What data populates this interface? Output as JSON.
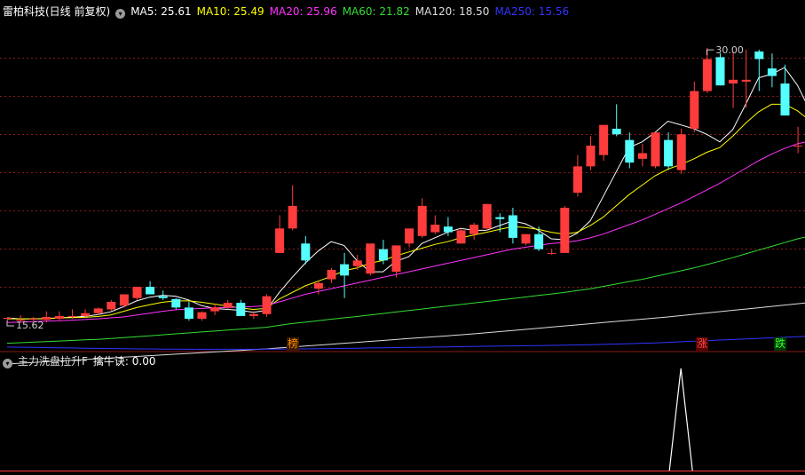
{
  "header": {
    "stock_title": "雷柏科技(日线 前复权)",
    "ma_labels": [
      {
        "text": "MA5: 25.61",
        "color": "#ffffff"
      },
      {
        "text": "MA10: 25.49",
        "color": "#ffff00"
      },
      {
        "text": "MA20: 25.96",
        "color": "#ff33ff"
      },
      {
        "text": "MA60: 21.82",
        "color": "#33dd33"
      },
      {
        "text": "MA120: 18.50",
        "color": "#dddddd"
      },
      {
        "text": "MA250: 15.56",
        "color": "#3333ff"
      }
    ]
  },
  "indicator": {
    "name": "主力洗盘拉升F",
    "value_label": "擒牛诀: 0.00"
  },
  "markers": {
    "high_label": "30.00",
    "low_label": "15.62",
    "tag_bang": "榜",
    "tag_zhang": "涨",
    "tag_die": "跌"
  },
  "colors": {
    "up": "#ff3c3c",
    "down": "#54ffff",
    "background": "#000000",
    "grid": "#8b1a1a",
    "ma5": "#ffffff",
    "ma10": "#ffff00",
    "ma20": "#ff33ff",
    "ma60": "#33dd33",
    "ma120": "#dddddd",
    "ma250": "#3333ff"
  },
  "chart_data": [
    {
      "type": "candlestick",
      "title": "雷柏科技(日线 前复权)",
      "ylim": [
        14.3,
        31.8
      ],
      "high_marker": 30.0,
      "low_marker": 15.62,
      "ohlc": [
        [
          15.9,
          16.0,
          15.8,
          15.95
        ],
        [
          15.8,
          16.1,
          15.7,
          15.85
        ],
        [
          15.9,
          16.0,
          15.8,
          15.9
        ],
        [
          15.85,
          16.3,
          15.7,
          16.0
        ],
        [
          15.9,
          16.3,
          15.8,
          16.05
        ],
        [
          16.0,
          16.4,
          15.9,
          16.05
        ],
        [
          16.05,
          16.4,
          16.0,
          16.2
        ],
        [
          16.2,
          16.5,
          16.1,
          16.45
        ],
        [
          16.4,
          16.9,
          16.3,
          16.8
        ],
        [
          16.6,
          17.1,
          16.5,
          17.2
        ],
        [
          17.0,
          17.6,
          16.9,
          17.6
        ],
        [
          17.6,
          17.9,
          17.4,
          17.2
        ],
        [
          17.1,
          17.4,
          16.9,
          17.0
        ],
        [
          16.95,
          17.0,
          16.4,
          16.5
        ],
        [
          16.5,
          16.8,
          15.8,
          15.9
        ],
        [
          15.9,
          16.3,
          15.8,
          16.25
        ],
        [
          16.3,
          16.7,
          16.1,
          16.5
        ],
        [
          16.5,
          16.9,
          16.4,
          16.75
        ],
        [
          16.75,
          16.9,
          16.1,
          16.05
        ],
        [
          16.05,
          16.3,
          15.9,
          16.15
        ],
        [
          16.15,
          17.2,
          16.0,
          17.1
        ],
        [
          19.4,
          21.4,
          19.4,
          20.7
        ],
        [
          20.7,
          23.0,
          20.6,
          21.9
        ],
        [
          19.9,
          20.3,
          18.8,
          19.0
        ],
        [
          17.5,
          17.9,
          17.2,
          17.8
        ],
        [
          18.0,
          18.6,
          17.8,
          18.5
        ],
        [
          18.8,
          19.4,
          17.0,
          18.2
        ],
        [
          18.7,
          19.3,
          18.5,
          19.0
        ],
        [
          18.3,
          19.8,
          18.2,
          19.9
        ],
        [
          19.6,
          20.1,
          18.8,
          19.0
        ],
        [
          18.4,
          19.8,
          18.1,
          19.8
        ],
        [
          19.9,
          20.5,
          19.7,
          20.7
        ],
        [
          20.3,
          22.3,
          20.2,
          21.9
        ],
        [
          20.5,
          21.4,
          20.4,
          20.9
        ],
        [
          20.8,
          21.3,
          20.3,
          20.5
        ],
        [
          19.9,
          20.7,
          19.9,
          20.6
        ],
        [
          20.4,
          21.0,
          20.1,
          20.9
        ],
        [
          20.7,
          22.0,
          20.6,
          22.0
        ],
        [
          21.3,
          21.5,
          20.5,
          21.2
        ],
        [
          21.4,
          21.8,
          19.9,
          20.2
        ],
        [
          19.9,
          20.4,
          19.8,
          20.4
        ],
        [
          20.4,
          20.8,
          19.5,
          19.6
        ],
        [
          19.4,
          19.6,
          19.3,
          19.4
        ],
        [
          19.4,
          21.9,
          19.4,
          21.8
        ],
        [
          22.6,
          24.6,
          22.4,
          24.0
        ],
        [
          24.0,
          25.6,
          23.8,
          25.1
        ],
        [
          24.6,
          26.2,
          24.3,
          26.2
        ],
        [
          26.0,
          27.3,
          25.6,
          25.7
        ],
        [
          25.4,
          25.8,
          23.9,
          24.2
        ],
        [
          24.4,
          25.2,
          24.0,
          24.7
        ],
        [
          24.0,
          25.8,
          23.9,
          25.8
        ],
        [
          25.4,
          25.8,
          23.8,
          24.0
        ],
        [
          23.8,
          26.0,
          23.6,
          25.7
        ],
        [
          26.0,
          28.5,
          25.8,
          28.0
        ],
        [
          28.0,
          30.3,
          27.9,
          29.7
        ],
        [
          29.8,
          30.0,
          28.3,
          28.3
        ],
        [
          28.4,
          30.1,
          27.1,
          28.6
        ],
        [
          28.5,
          30.2,
          27.1,
          28.6
        ],
        [
          30.1,
          30.2,
          28.0,
          29.7
        ],
        [
          29.2,
          30.0,
          28.2,
          28.8
        ],
        [
          28.4,
          29.4,
          26.9,
          26.7
        ],
        [
          25.1,
          26.1,
          24.7,
          25.1
        ],
        [
          24.8,
          26.6,
          23.6,
          24.3
        ]
      ],
      "ma_series": {
        "MA5": [
          15.95,
          15.9,
          15.9,
          15.92,
          15.95,
          15.98,
          16.03,
          16.12,
          16.27,
          16.55,
          16.85,
          17.05,
          17.15,
          17.1,
          16.9,
          16.6,
          16.45,
          16.4,
          16.35,
          16.25,
          16.35,
          17.3,
          18.1,
          18.85,
          19.5,
          20.0,
          19.8,
          19.0,
          18.4,
          18.4,
          18.95,
          19.2,
          19.9,
          20.2,
          20.5,
          20.7,
          20.6,
          20.6,
          20.85,
          21.1,
          20.95,
          20.6,
          20.15,
          20.1,
          20.45,
          21.1,
          22.4,
          23.7,
          25.0,
          25.3,
          25.8,
          26.4,
          26.2,
          26.0,
          25.7,
          25.3,
          25.95,
          27.3,
          28.7,
          28.9,
          29.25,
          28.3,
          26.9
        ],
        "MA10": [
          15.9,
          15.9,
          15.9,
          15.9,
          15.95,
          15.96,
          15.98,
          16.02,
          16.1,
          16.3,
          16.5,
          16.65,
          16.78,
          16.85,
          16.85,
          16.78,
          16.68,
          16.58,
          16.48,
          16.4,
          16.45,
          16.95,
          17.3,
          17.65,
          17.9,
          18.15,
          18.45,
          18.6,
          18.85,
          19.0,
          19.25,
          19.45,
          19.65,
          19.85,
          20.0,
          20.2,
          20.35,
          20.5,
          20.65,
          20.8,
          20.75,
          20.65,
          20.5,
          20.4,
          20.5,
          20.85,
          21.3,
          21.9,
          22.5,
          23.0,
          23.5,
          23.85,
          24.1,
          24.4,
          24.75,
          25.0,
          25.6,
          26.3,
          26.9,
          27.3,
          27.3,
          26.95,
          26.4
        ],
        "MA20": [
          15.7,
          15.72,
          15.75,
          15.78,
          15.8,
          15.83,
          15.86,
          15.9,
          15.95,
          16.0,
          16.1,
          16.2,
          16.3,
          16.38,
          16.42,
          16.45,
          16.48,
          16.5,
          16.52,
          16.55,
          16.6,
          16.8,
          17.0,
          17.2,
          17.35,
          17.5,
          17.65,
          17.8,
          17.95,
          18.1,
          18.25,
          18.4,
          18.55,
          18.7,
          18.85,
          19.0,
          19.15,
          19.3,
          19.45,
          19.6,
          19.7,
          19.8,
          19.9,
          19.95,
          20.05,
          20.2,
          20.4,
          20.65,
          20.9,
          21.15,
          21.45,
          21.75,
          22.05,
          22.4,
          22.75,
          23.1,
          23.5,
          23.9,
          24.3,
          24.65,
          24.95,
          25.2,
          25.35
        ],
        "MA60": [
          14.6,
          14.63,
          14.66,
          14.69,
          14.72,
          14.75,
          14.78,
          14.81,
          14.85,
          14.9,
          14.95,
          15.0,
          15.05,
          15.1,
          15.15,
          15.2,
          15.25,
          15.3,
          15.35,
          15.4,
          15.45,
          15.55,
          15.65,
          15.72,
          15.8,
          15.88,
          15.95,
          16.02,
          16.1,
          16.18,
          16.26,
          16.34,
          16.42,
          16.5,
          16.58,
          16.66,
          16.74,
          16.82,
          16.9,
          16.98,
          17.06,
          17.14,
          17.22,
          17.3,
          17.4,
          17.5,
          17.62,
          17.75,
          17.88,
          18.0,
          18.15,
          18.3,
          18.45,
          18.6,
          18.78,
          18.96,
          19.15,
          19.35,
          19.55,
          19.75,
          19.95,
          20.15,
          20.3
        ],
        "MA120": [
          13.5,
          13.54,
          13.58,
          13.62,
          13.66,
          13.7,
          13.74,
          13.78,
          13.82,
          13.86,
          13.9,
          13.94,
          13.98,
          14.02,
          14.06,
          14.1,
          14.14,
          14.18,
          14.22,
          14.26,
          14.3,
          14.35,
          14.4,
          14.45,
          14.5,
          14.55,
          14.6,
          14.65,
          14.7,
          14.75,
          14.8,
          14.85,
          14.9,
          14.95,
          15.0,
          15.05,
          15.1,
          15.16,
          15.22,
          15.28,
          15.34,
          15.4,
          15.46,
          15.52,
          15.58,
          15.64,
          15.7,
          15.76,
          15.82,
          15.88,
          15.94,
          16.0,
          16.07,
          16.14,
          16.21,
          16.28,
          16.35,
          16.42,
          16.49,
          16.56,
          16.63,
          16.7,
          16.77
        ],
        "MA250": [
          14.4,
          14.39,
          14.38,
          14.37,
          14.36,
          14.35,
          14.34,
          14.33,
          14.32,
          14.31,
          14.3,
          14.3,
          14.29,
          14.29,
          14.28,
          14.28,
          14.28,
          14.28,
          14.28,
          14.28,
          14.29,
          14.29,
          14.3,
          14.3,
          14.31,
          14.32,
          14.33,
          14.34,
          14.35,
          14.36,
          14.37,
          14.38,
          14.39,
          14.4,
          14.41,
          14.42,
          14.43,
          14.44,
          14.45,
          14.46,
          14.47,
          14.48,
          14.49,
          14.5,
          14.51,
          14.52,
          14.54,
          14.56,
          14.58,
          14.6,
          14.62,
          14.65,
          14.68,
          14.71,
          14.74,
          14.77,
          14.8,
          14.83,
          14.86,
          14.89,
          14.92,
          14.95,
          14.98
        ]
      }
    },
    {
      "type": "line",
      "title": "主力洗盘拉升F",
      "series": [
        {
          "name": "擒牛诀",
          "values": [
            0,
            0,
            0,
            0,
            0,
            0,
            0,
            0,
            0,
            0,
            0,
            0,
            0,
            0,
            0,
            0,
            0,
            0,
            0,
            0,
            0,
            0,
            0,
            0,
            0,
            0,
            0,
            0,
            0,
            0,
            0,
            0,
            0,
            0,
            0,
            0,
            0,
            0,
            0,
            0,
            0,
            0,
            0,
            0,
            0,
            0,
            0,
            0,
            0,
            0,
            0,
            0,
            1,
            0,
            0,
            0,
            0,
            0,
            0,
            0,
            0,
            0,
            0
          ]
        }
      ],
      "ylim": [
        0,
        1
      ]
    }
  ]
}
